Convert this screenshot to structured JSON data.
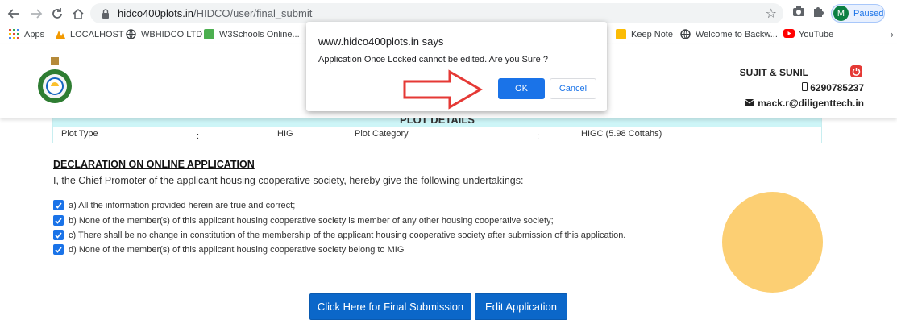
{
  "browser": {
    "url_host": "hidco400plots.in",
    "url_path": "/HIDCO/user/final_submit",
    "profile_initial": "M",
    "profile_status": "Paused",
    "bookmarks": [
      "Apps",
      "LOCALHOST",
      "WBHIDCO LTD",
      "W3Schools Online...",
      "Keep Note",
      "Welcome to Backw...",
      "YouTube"
    ]
  },
  "header": {
    "user_name": "SUJIT & SUNIL",
    "phone": "6290785237",
    "email": "mack.r@diligenttech.in"
  },
  "plot": {
    "title": "PLOT DETAILS",
    "type_label": "Plot Type",
    "type_value": "HIG",
    "category_label": "Plot Category",
    "category_value": "HIGC (5.98 Cottahs)",
    "separator": ":"
  },
  "declaration": {
    "title": "DECLARATION ON ONLINE APPLICATION",
    "intro": "I, the Chief Promoter of the applicant housing cooperative society, hereby give the following undertakings:",
    "items": [
      "a) All the information provided herein are true and correct;",
      "b) None of the member(s) of this applicant housing cooperative society is member of any other housing cooperative society;",
      "c) There shall be no change in constitution of the membership of the applicant housing cooperative society after submission of this application.",
      "d) None of the member(s) of this applicant housing cooperative society belong to MIG"
    ]
  },
  "actions": {
    "final_submit": "Click Here for Final Submission",
    "edit": "Edit Application"
  },
  "dialog": {
    "title": "www.hidco400plots.in says",
    "message": "Application Once Locked cannot be edited. Are you Sure ?",
    "ok": "OK",
    "cancel": "Cancel"
  },
  "colors": {
    "accent": "#1a73e8",
    "primary_button": "#0b67c9",
    "plot_header": "#cdf5f7",
    "circle": "#fccf73",
    "arrow": "#e53935"
  }
}
